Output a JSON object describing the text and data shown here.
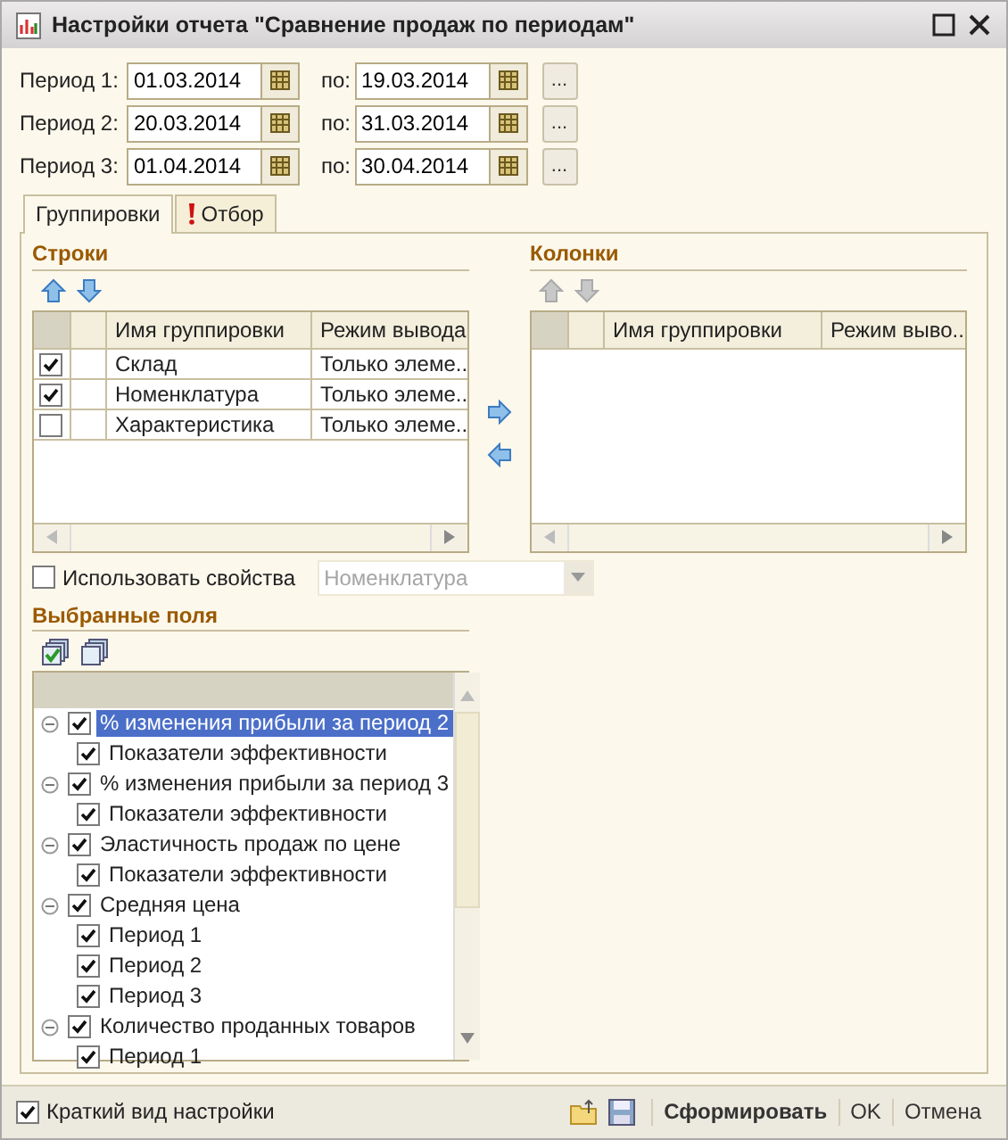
{
  "window": {
    "title": "Настройки отчета \"Сравнение продаж по периодам\""
  },
  "periods": [
    {
      "label": "Период 1:",
      "from": "01.03.2014",
      "to_label": "по:",
      "to": "19.03.2014",
      "more": "..."
    },
    {
      "label": "Период 2:",
      "from": "20.03.2014",
      "to_label": "по:",
      "to": "31.03.2014",
      "more": "..."
    },
    {
      "label": "Период 3:",
      "from": "01.04.2014",
      "to_label": "по:",
      "to": "30.04.2014",
      "more": "..."
    }
  ],
  "tabs": [
    {
      "label": "Группировки",
      "selected": true,
      "kind": "plain"
    },
    {
      "label": "Отбор",
      "selected": false,
      "kind": "warning"
    }
  ],
  "rows_section": {
    "title": "Строки",
    "columns": [
      "Имя группировки",
      "Режим вывода"
    ],
    "rows": [
      {
        "checked": true,
        "name": "Склад",
        "mode": "Только элеме.."
      },
      {
        "checked": true,
        "name": "Номенклатура",
        "mode": "Только элеме.."
      },
      {
        "checked": false,
        "name": "Характеристика",
        "mode": "Только элеме.."
      }
    ]
  },
  "columns_section": {
    "title": "Колонки",
    "columns": [
      "Имя группировки",
      "Режим выво.."
    ]
  },
  "use_properties": {
    "label": "Использовать свойства",
    "checked": false,
    "value": "Номенклатура",
    "disabled": true
  },
  "selected_fields": {
    "title": "Выбранные поля",
    "items": [
      {
        "label": "% изменения прибыли за период 2",
        "checked": true,
        "expanded": true,
        "selected": true,
        "children": [
          {
            "label": "Показатели эффективности",
            "checked": true,
            "selected": false
          }
        ]
      },
      {
        "label": "% изменения прибыли за период 3",
        "checked": true,
        "expanded": true,
        "selected": false,
        "children": [
          {
            "label": "Показатели эффективности",
            "checked": true,
            "selected": false
          }
        ]
      },
      {
        "label": "Эластичность продаж по цене",
        "checked": true,
        "expanded": true,
        "selected": false,
        "children": [
          {
            "label": "Показатели эффективности",
            "checked": true,
            "selected": false
          }
        ]
      },
      {
        "label": "Средняя цена",
        "checked": true,
        "expanded": true,
        "selected": false,
        "children": [
          {
            "label": "Период 1",
            "checked": true,
            "selected": false
          },
          {
            "label": "Период 2",
            "checked": true,
            "selected": false
          },
          {
            "label": "Период 3",
            "checked": true,
            "selected": false
          }
        ]
      },
      {
        "label": "Количество проданных товаров",
        "checked": true,
        "expanded": true,
        "selected": false,
        "children": [
          {
            "label": "Период 1",
            "checked": true,
            "selected": false
          }
        ]
      }
    ]
  },
  "footer": {
    "short_view": {
      "label": "Краткий вид настройки",
      "checked": true
    },
    "buttons": [
      {
        "label": "Сформировать",
        "kind": "default"
      },
      {
        "label": "OK",
        "kind": "plain"
      },
      {
        "label": "Отмена",
        "kind": "plain"
      }
    ]
  }
}
